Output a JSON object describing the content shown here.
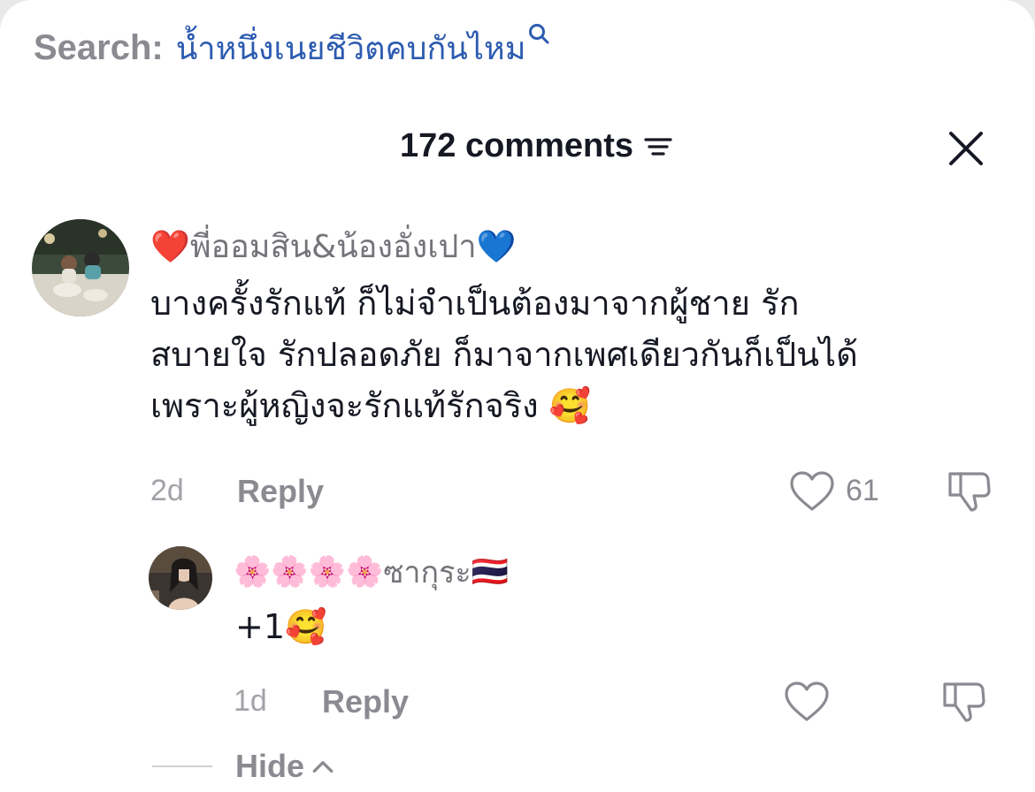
{
  "search": {
    "label": "Search:",
    "query": "น้ำหนึ่งเนยชีวิตคบกันไหม",
    "icon": "search-icon"
  },
  "header": {
    "comment_count": "172 comments",
    "sort_icon": "sort-icon",
    "close_icon": "close-icon"
  },
  "comments": [
    {
      "username_prefix": "❤️",
      "username": "พี่ออมสิน&น้องอั่งเปา",
      "username_suffix": "💙",
      "lines": [
        "บางครั้งรักแท้ ก็ไม่จำเป็นต้องมาจากผู้ชาย รัก",
        "สบายใจ รักปลอดภัย ก็มาจากเพศเดียวกันก็เป็นได้",
        "เพราะผู้หญิงจะรักแท้รักจริง 🥰"
      ],
      "date": "2d",
      "reply_label": "Reply",
      "likes": "61"
    },
    {
      "username_prefix": "🌸🌸🌸🌸",
      "username": "ซากุระ",
      "username_suffix": "🇹🇭",
      "text": "+1🥰",
      "date": "1d",
      "reply_label": "Reply"
    }
  ],
  "hide_label": "Hide",
  "colors": {
    "accent_blue": "#2c5bb0",
    "text_primary": "#161823",
    "text_secondary": "#8a8b91"
  }
}
